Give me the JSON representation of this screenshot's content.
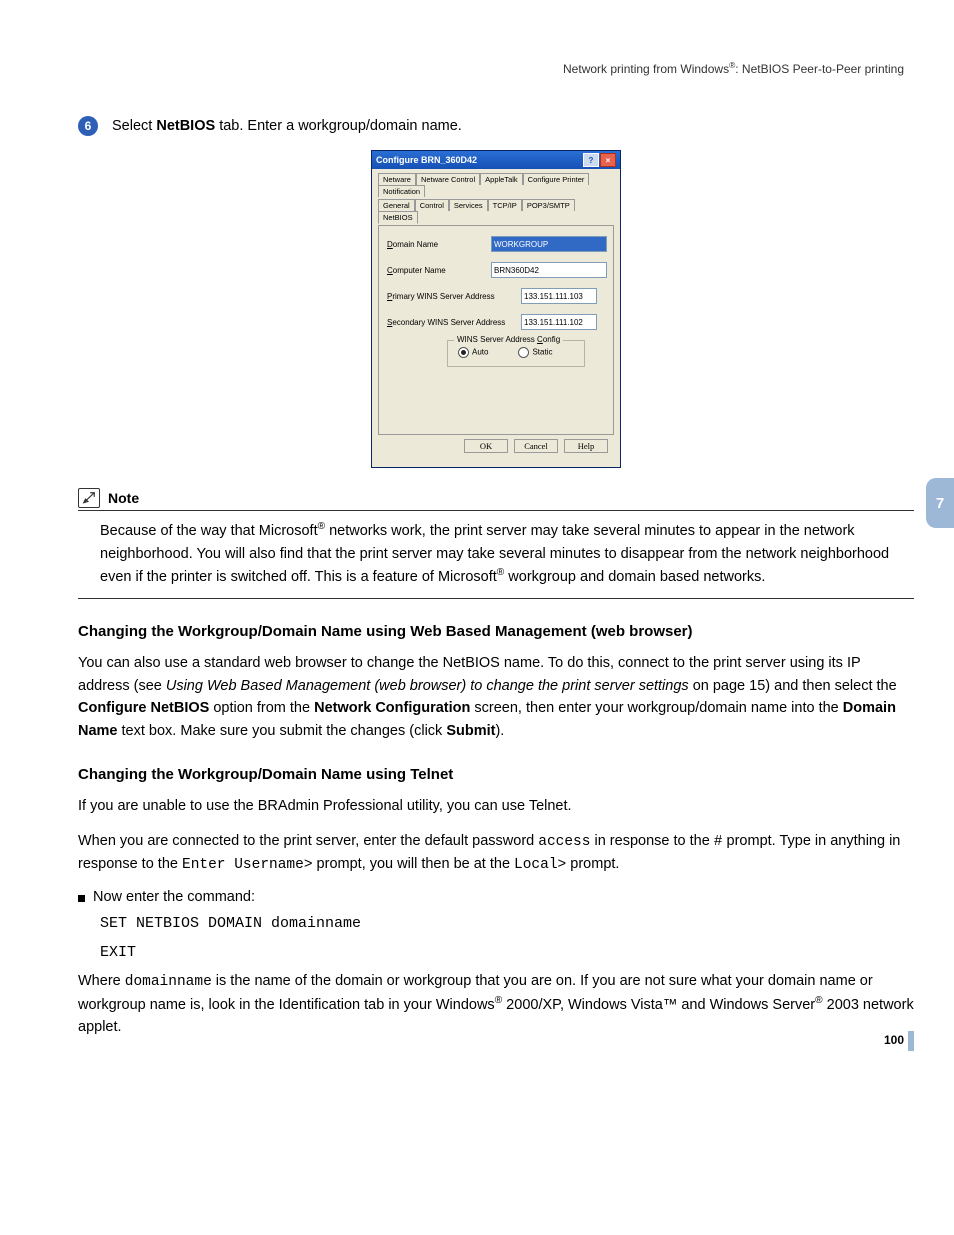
{
  "header": {
    "text_before_reg": "Network printing from Windows",
    "text_after_reg": ": NetBIOS Peer-to-Peer printing"
  },
  "step": {
    "number": "6",
    "text_before": "Select ",
    "netbios": "NetBIOS",
    "text_after": " tab. Enter a workgroup/domain name."
  },
  "dialog": {
    "title": "Configure BRN_360D42",
    "tabs_row1": [
      "Netware",
      "Netware Control",
      "AppleTalk",
      "Configure Printer",
      "Notification"
    ],
    "tabs_row2": [
      "General",
      "Control",
      "Services",
      "TCP/IP",
      "POP3/SMTP",
      "NetBIOS"
    ],
    "fields": {
      "domain_name": {
        "label": "Domain Name",
        "value": "WORKGROUP"
      },
      "computer_name": {
        "label": "Computer Name",
        "value": "BRN360D42"
      },
      "primary_wins": {
        "label": "Primary WINS Server Address",
        "value": "133.151.111.103"
      },
      "secondary_wins": {
        "label": "Secondary WINS Server Address",
        "value": "133.151.111.102"
      }
    },
    "fieldset": {
      "legend": "WINS Server Address Config",
      "auto": "Auto",
      "static": "Static"
    },
    "buttons": {
      "ok": "OK",
      "cancel": "Cancel",
      "help": "Help"
    }
  },
  "note": {
    "label": "Note",
    "p1a": "Because of the way that Microsoft",
    "p1b": " networks work, the print server may take several minutes to appear in the network neighborhood. You will also find that the print server may take several minutes to disappear from the network neighborhood even if the printer is switched off. This is a feature of Microsoft",
    "p1c": " workgroup and domain based networks."
  },
  "section_web": {
    "heading": "Changing the Workgroup/Domain Name using Web Based Management (web browser)",
    "p_a": "You can also use a standard web browser to change the NetBIOS name. To do this, connect to the print server using its IP address (see ",
    "p_italic": "Using Web Based Management (web browser) to change the print server settings",
    "p_b": " on page 15) and then select the ",
    "bold1": "Configure NetBIOS",
    "p_c": " option from the ",
    "bold2": "Network Configuration",
    "p_d": " screen, then enter your workgroup/domain name into the ",
    "bold3": "Domain Name",
    "p_e": " text box. Make sure you submit the changes (click ",
    "bold4": "Submit",
    "p_f": ")."
  },
  "section_telnet": {
    "heading": "Changing the Workgroup/Domain Name using Telnet",
    "p1": "If you are unable to use the BRAdmin Professional utility, you can use Telnet.",
    "p2a": "When you are connected to the print server, enter the default password ",
    "code1": "access",
    "p2b": " in response to the ",
    "code2": "#",
    "p2c": " prompt. Type in anything in response to the ",
    "code3": "Enter Username>",
    "p2d": " prompt, you will then be at the ",
    "code4": "Local>",
    "p2e": " prompt.",
    "bullet": "Now enter the command:",
    "cmd1": "SET NETBIOS DOMAIN domainname",
    "cmd2": "EXIT",
    "p3a": "Where ",
    "code5": "domainname",
    "p3b": " is the name of the domain or workgroup that you are on. If you are not sure what your domain name or workgroup name is, look in the Identification tab in your Windows",
    "p3c": " 2000/XP, Windows Vista™ and Windows Server",
    "p3d": " 2003 network applet."
  },
  "side_tab": "7",
  "page_number": "100"
}
